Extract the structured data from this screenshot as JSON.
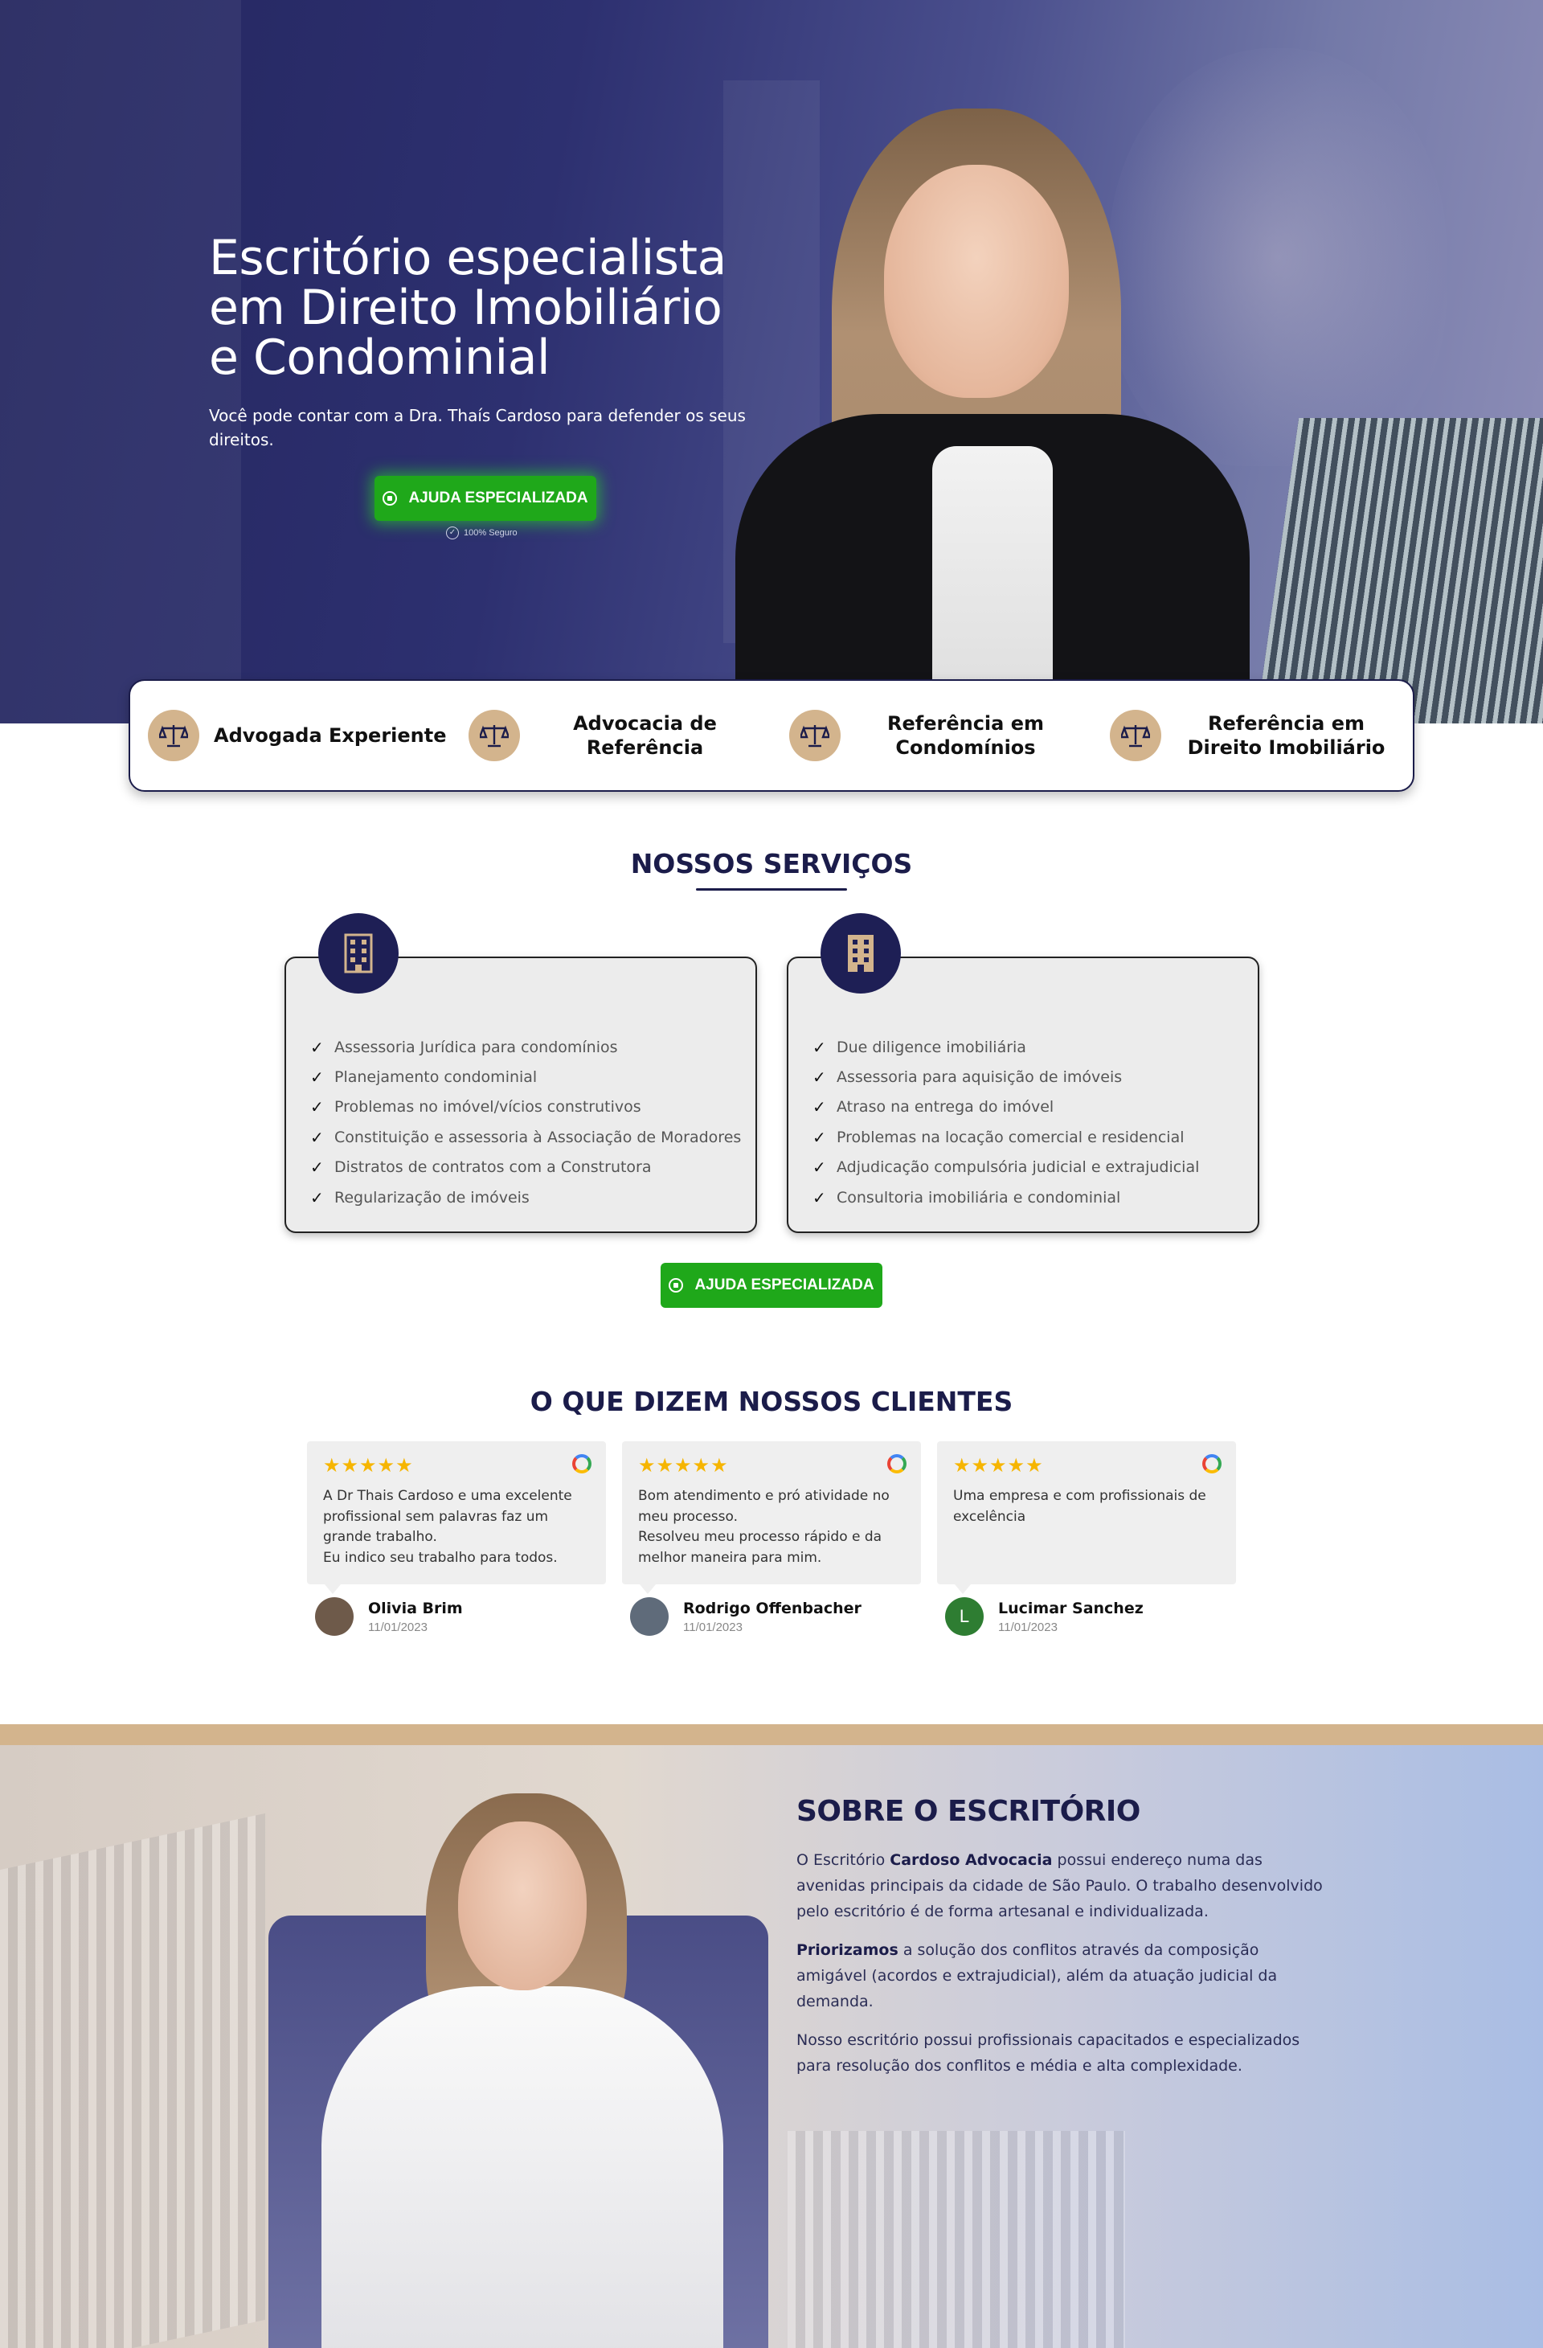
{
  "hero": {
    "title_line1": "Escritório especialista",
    "title_line2": "em Direito Imobiliário",
    "title_line3": "e Condominial",
    "subtitle": "Você pode contar com a Dra. Thaís Cardoso para defender os seus direitos.",
    "cta_label": "AJUDA ESPECIALIZADA",
    "secure_label": "100% Seguro"
  },
  "features": [
    {
      "label": "Advogada Experiente"
    },
    {
      "label": "Advocacia de Referência"
    },
    {
      "label": "Referência em Condomínios"
    },
    {
      "label": "Referência em Direito Imobiliário"
    }
  ],
  "services": {
    "title": "NOSSOS SERVIÇOS",
    "cards": [
      {
        "items": [
          "Assessoria Jurídica para condomínios",
          "Planejamento condominial",
          "Problemas no imóvel/vícios construtivos",
          "Constituição e assessoria à Associação de Moradores",
          "Distratos de contratos com a Construtora",
          "Regularização de imóveis"
        ]
      },
      {
        "items": [
          "Due diligence imobiliária",
          "Assessoria para aquisição de imóveis",
          "Atraso na entrega do imóvel",
          "Problemas na locação comercial e residencial",
          "Adjudicação compulsória judicial e extrajudicial",
          "Consultoria imobiliária e condominial"
        ]
      }
    ],
    "cta_label": "AJUDA ESPECIALIZADA"
  },
  "reviews": {
    "title": "O QUE DIZEM NOSSOS CLIENTES",
    "stars": "★★★★★",
    "items": [
      {
        "text": "A Dr Thais Cardoso e uma excelente profissional sem palavras faz um grande trabalho.\nEu indico seu trabalho para todos.",
        "name": "Olivia Brim",
        "date": "11/01/2023",
        "avatar": ""
      },
      {
        "text": "Bom atendimento e pró atividade no meu processo.\nResolveu meu processo rápido e da melhor maneira para mim.",
        "name": "Rodrigo Offenbacher",
        "date": "11/01/2023",
        "avatar": ""
      },
      {
        "text": "Uma empresa e com profissionais de excelência",
        "name": "Lucimar Sanchez",
        "date": "11/01/2023",
        "avatar": "L"
      }
    ]
  },
  "about": {
    "title": "SOBRE O ESCRITÓRIO",
    "p1_pre": "O Escritório ",
    "p1_bold": "Cardoso Advocacia",
    "p1_post": " possui endereço numa das avenidas principais da cidade de São Paulo. O trabalho desenvolvido pelo escritório é de forma artesanal e individualizada.",
    "p2_bold": "Priorizamos",
    "p2_post": " a solução dos conflitos através da composição amigável (acordos e extrajudicial), além da atuação judicial da demanda.",
    "p3": "Nosso escritório possui profissionais capacitados e especializados para resolução dos conflitos e média e alta complexidade."
  },
  "colors": {
    "navy": "#1b1c4a",
    "gold": "#d3b48d",
    "whatsapp_green": "#1fa81a",
    "star": "#f6b500"
  }
}
